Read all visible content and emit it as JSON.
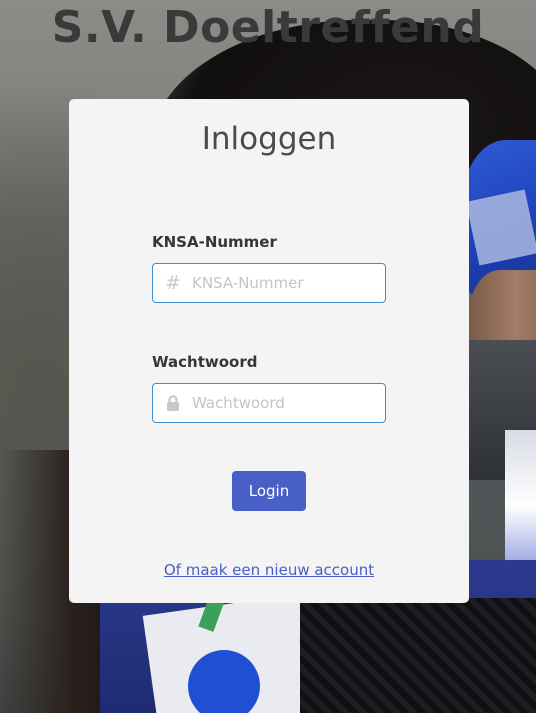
{
  "site": {
    "title": "S.V. Doeltreffend"
  },
  "login_card": {
    "title": "Inloggen",
    "knsa": {
      "label": "KNSA-Nummer",
      "placeholder": "KNSA-Nummer",
      "value": "",
      "icon": "hash-icon",
      "icon_glyph": "#"
    },
    "password": {
      "label": "Wachtwoord",
      "placeholder": "Wachtwoord",
      "value": "",
      "icon": "lock-icon"
    },
    "login_button": "Login",
    "register_link": "Of maak een nieuw account"
  },
  "colors": {
    "primary": "#485fc7",
    "input_border": "#3e8ed0",
    "card_background": "#f4f4f4",
    "title_text": "#3a3a3a"
  }
}
